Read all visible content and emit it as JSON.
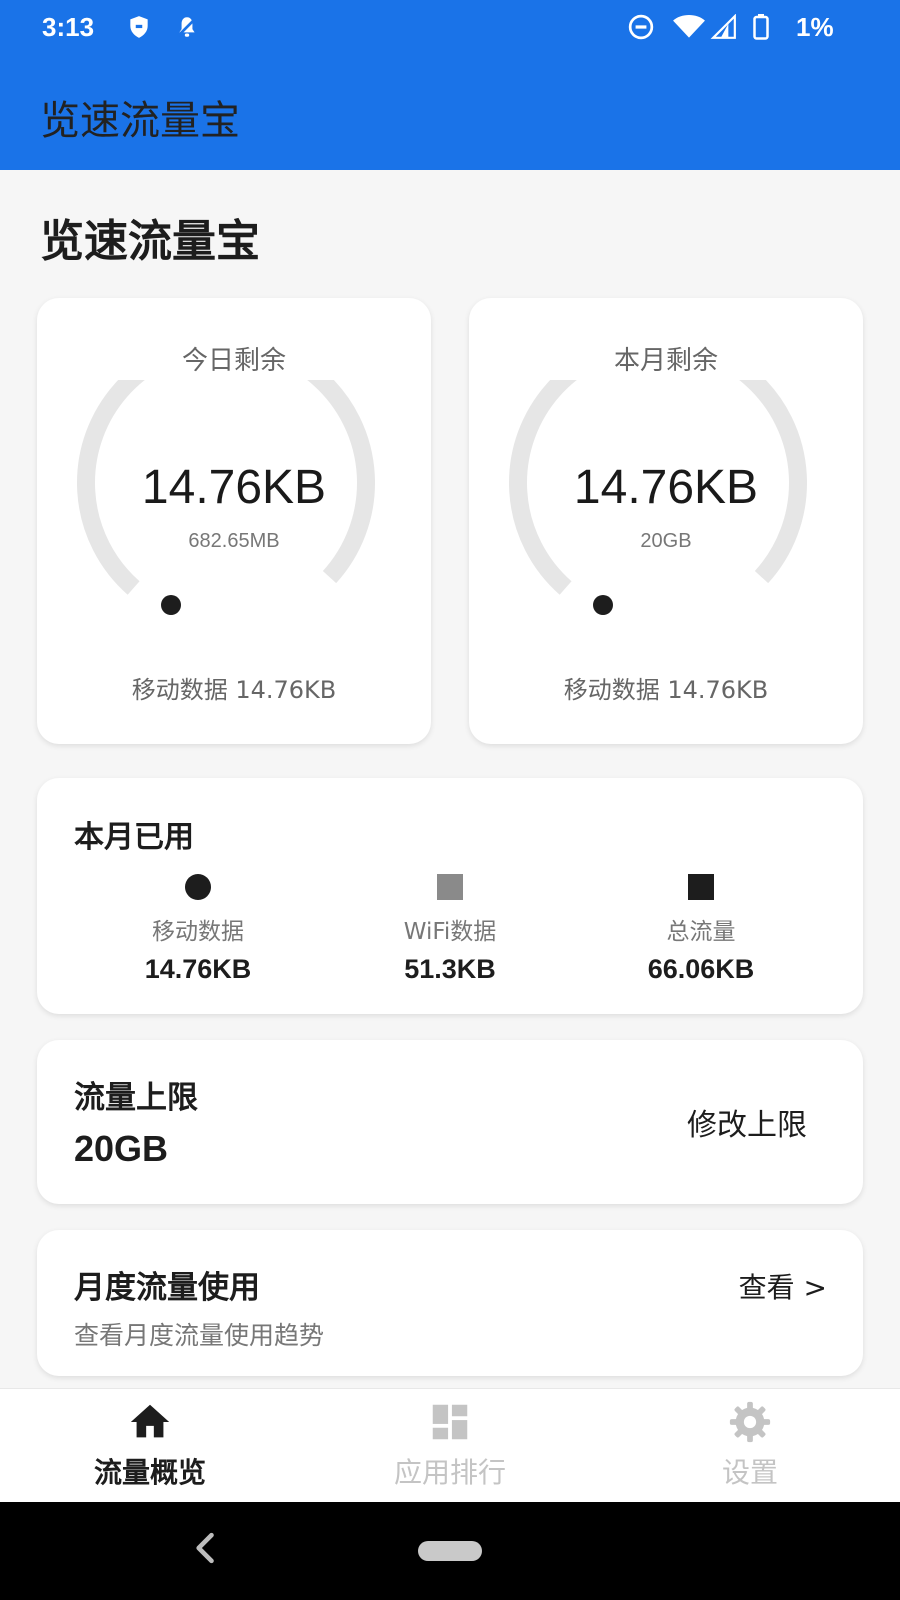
{
  "status_bar": {
    "time": "3:13",
    "battery_text": "1%"
  },
  "app_bar": {
    "title": "览速流量宝"
  },
  "page": {
    "heading": "览速流量宝"
  },
  "today_card": {
    "label": "今日剩余",
    "remaining": "14.76KB",
    "total": "682.65MB",
    "footer": "移动数据 14.76KB"
  },
  "month_card": {
    "label": "本月剩余",
    "remaining": "14.76KB",
    "total": "20GB",
    "footer": "移动数据 14.76KB"
  },
  "monthly_used": {
    "heading": "本月已用",
    "stats": [
      {
        "name": "移动数据",
        "value": "14.76KB",
        "marker": "circle",
        "color": "#1d1d1d"
      },
      {
        "name": "WiFi数据",
        "value": "51.3KB",
        "marker": "square",
        "color": "#8a8a8a"
      },
      {
        "name": "总流量",
        "value": "66.06KB",
        "marker": "square",
        "color": "#1d1d1d"
      }
    ]
  },
  "limit": {
    "heading": "流量上限",
    "value": "20GB",
    "edit_label": "修改上限"
  },
  "monthly_usage": {
    "heading": "月度流量使用",
    "description": "查看月度流量使用趋势",
    "view_label": "查看 >"
  },
  "bottom_nav": {
    "items": [
      {
        "label": "流量概览",
        "icon": "home-icon",
        "active": true
      },
      {
        "label": "应用排行",
        "icon": "dashboard-icon",
        "active": false
      },
      {
        "label": "设置",
        "icon": "gear-icon",
        "active": false
      }
    ]
  },
  "colors": {
    "primary": "#1a73e8",
    "track": "#e6e6e6",
    "text_dark": "#1d1d1d",
    "text_muted": "#777777"
  }
}
